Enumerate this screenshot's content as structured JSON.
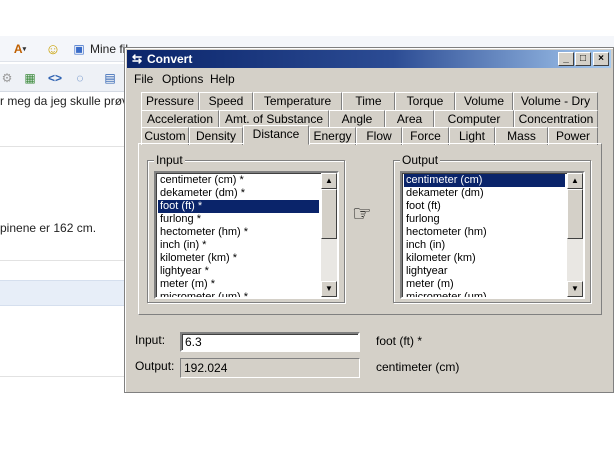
{
  "background_app": {
    "mine_filer_label": "Mine fil",
    "text_line_1": "r meg da jeg skulle prøv",
    "text_line_2": "pinene er 162 cm."
  },
  "window": {
    "title": "Convert",
    "title_icon": "arrows-convert-icon",
    "minimize_glyph": "_",
    "maximize_glyph": "□",
    "close_glyph": "×"
  },
  "menu": [
    "File",
    "Options",
    "Help"
  ],
  "tabs": {
    "row1": [
      "Pressure",
      "Speed",
      "Temperature",
      "Time",
      "Torque",
      "Volume",
      "Volume - Dry"
    ],
    "row2": [
      "Acceleration",
      "Amt. of Substance",
      "Angle",
      "Area",
      "Computer",
      "Concentration"
    ],
    "row3": [
      "Custom",
      "Density",
      "Distance",
      "Energy",
      "Flow",
      "Force",
      "Light",
      "Mass",
      "Power"
    ],
    "active": "Distance"
  },
  "input_group": {
    "label": "Input",
    "items": [
      "centimeter (cm) *",
      "dekameter (dm) *",
      "foot (ft) *",
      "furlong *",
      "hectometer (hm) *",
      "inch (in) *",
      "kilometer (km) *",
      "lightyear *",
      "meter (m) *",
      "micrometer (um) *"
    ],
    "selected": "foot (ft) *"
  },
  "output_group": {
    "label": "Output",
    "items": [
      "centimeter (cm)",
      "dekameter (dm)",
      "foot (ft)",
      "furlong",
      "hectometer (hm)",
      "inch (in)",
      "kilometer (km)",
      "lightyear",
      "meter (m)",
      "micrometer (um)"
    ],
    "selected": "centimeter (cm)"
  },
  "convert_icon": "pointing-hand-icon",
  "input_field": {
    "label": "Input:",
    "value": "6.3",
    "unit": "foot (ft) *"
  },
  "output_field": {
    "label": "Output:",
    "value": "192.024",
    "unit": "centimeter (cm)"
  }
}
